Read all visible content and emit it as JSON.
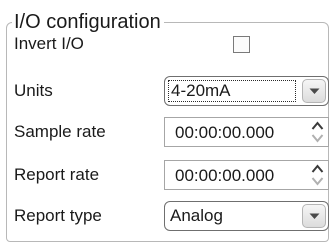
{
  "group": {
    "title": "I/O configuration"
  },
  "invert_io": {
    "label": "Invert I/O",
    "checked": false
  },
  "units": {
    "label": "Units",
    "value": "4-20mA",
    "icon": "chevron-down-icon"
  },
  "sample_rate": {
    "label": "Sample rate",
    "value": "00:00:00.000",
    "icon": "spin-arrows-icon"
  },
  "report_rate": {
    "label": "Report rate",
    "value": "00:00:00.000",
    "icon": "spin-arrows-icon"
  },
  "report_type": {
    "label": "Report type",
    "value": "Analog",
    "icon": "chevron-down-icon"
  }
}
